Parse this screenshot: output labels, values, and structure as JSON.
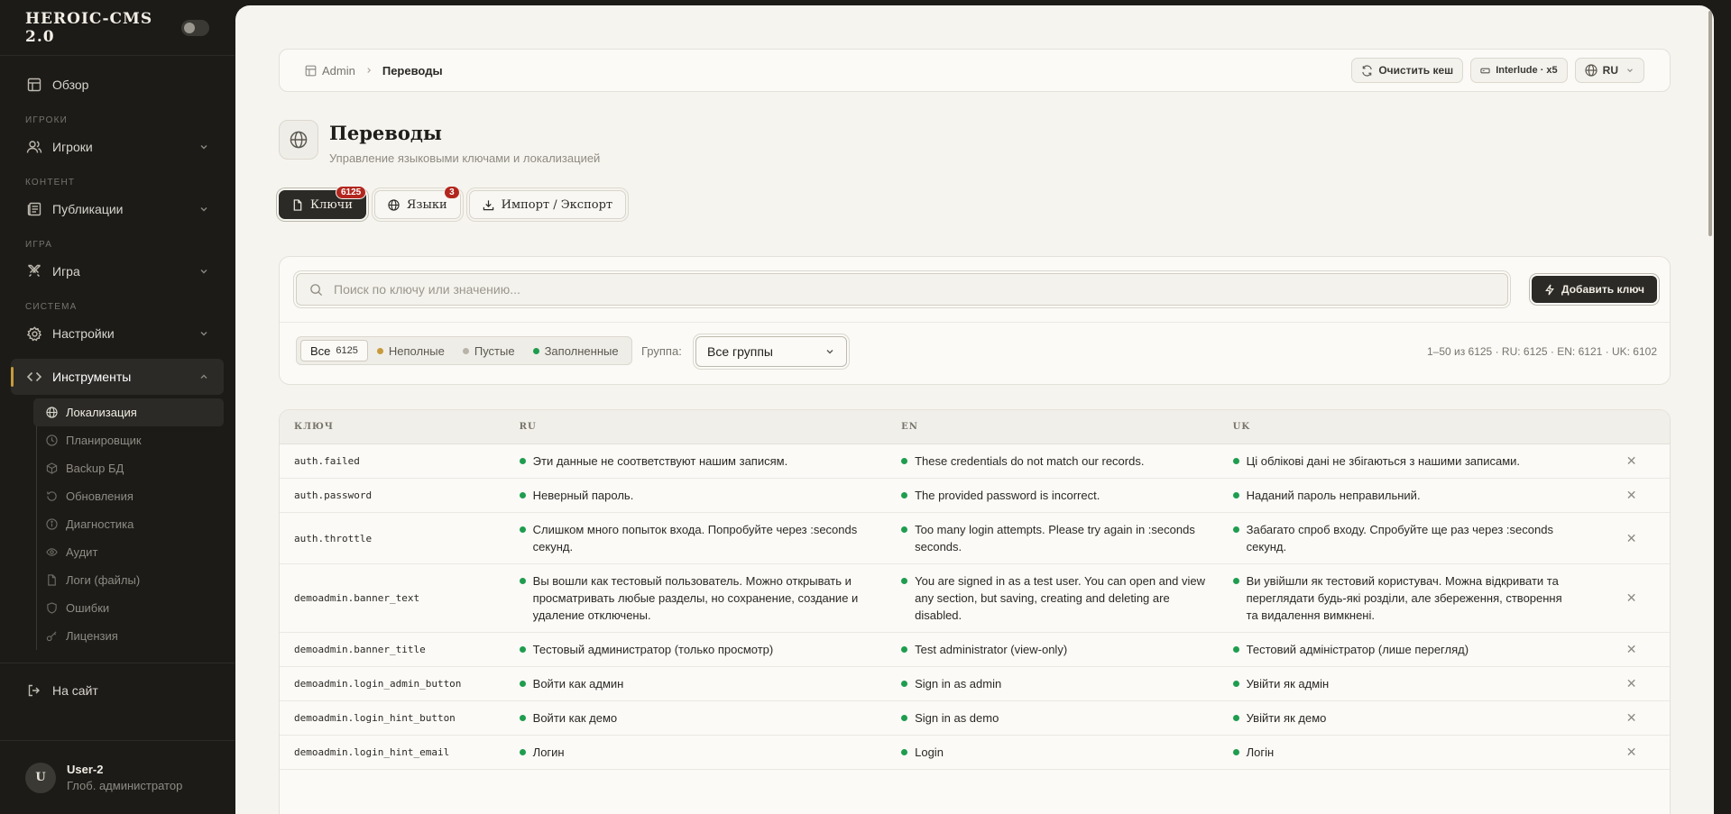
{
  "brand": {
    "title": "HEROIC-CMS 2.0"
  },
  "sidebar": {
    "overview": "Обзор",
    "sections": {
      "players": "ИГРОКИ",
      "content": "КОНТЕНТ",
      "game": "ИГРА",
      "system": "СИСТЕМА"
    },
    "players": "Игроки",
    "publications": "Публикации",
    "game": "Игра",
    "settings": "Настройки",
    "tools": "Инструменты",
    "tool_items": [
      "Локализация",
      "Планировщик",
      "Backup БД",
      "Обновления",
      "Диагностика",
      "Аудит",
      "Логи (файлы)",
      "Ошибки",
      "Лицензия"
    ],
    "to_site": "На сайт"
  },
  "user": {
    "initial": "U",
    "name": "User-2",
    "role": "Глоб. администратор"
  },
  "topbar": {
    "crumb_root": "Admin",
    "crumb_current": "Переводы",
    "clear_cache": "Очистить кеш",
    "server": "Interlude · x5",
    "lang": "RU"
  },
  "page": {
    "title": "Переводы",
    "subtitle": "Управление языковыми ключами и локализацией"
  },
  "tabs": {
    "keys": "Ключи",
    "keys_badge": "6125",
    "languages": "Языки",
    "languages_badge": "3",
    "import_export": "Импорт / Экспорт"
  },
  "filters": {
    "search_placeholder": "Поиск по ключу или значению...",
    "add_key": "Добавить ключ",
    "all": "Все",
    "all_count": "6125",
    "incomplete": "Неполные",
    "empty": "Пустые",
    "filled": "Заполненные",
    "group_label": "Группа:",
    "group_value": "Все группы",
    "stats": "1–50 из 6125 · RU: 6125 · EN: 6121 · UK: 6102"
  },
  "colors": {
    "incomplete": "#c79a3b",
    "empty": "#b8b4aa",
    "filled": "#1f9d4f"
  },
  "table": {
    "headers": {
      "key": "КЛЮЧ",
      "ru": "RU",
      "en": "EN",
      "uk": "UK"
    },
    "rows": [
      {
        "key": "auth.failed",
        "ru": "Эти данные не соответствуют нашим записям.",
        "en": "These credentials do not match our records.",
        "uk": "Ці облікові дані не збігаються з нашими записами."
      },
      {
        "key": "auth.password",
        "ru": "Неверный пароль.",
        "en": "The provided password is incorrect.",
        "uk": "Наданий пароль неправильний."
      },
      {
        "key": "auth.throttle",
        "ru": "Слишком много попыток входа. Попробуйте через :seconds секунд.",
        "en": "Too many login attempts. Please try again in :seconds seconds.",
        "uk": "Забагато спроб входу. Спробуйте ще раз через :seconds секунд."
      },
      {
        "key": "demoadmin.banner_text",
        "ru": "Вы вошли как тестовый пользователь. Можно открывать и просматривать любые разделы, но сохранение, создание и удаление отключены.",
        "en": "You are signed in as a test user. You can open and view any section, but saving, creating and deleting are disabled.",
        "uk": "Ви увійшли як тестовий користувач. Можна відкривати та переглядати будь-які розділи, але збереження, створення та видалення вимкнені."
      },
      {
        "key": "demoadmin.banner_title",
        "ru": "Тестовый администратор (только просмотр)",
        "en": "Test administrator (view-only)",
        "uk": "Тестовий адміністратор (лише перегляд)"
      },
      {
        "key": "demoadmin.login_admin_button",
        "ru": "Войти как админ",
        "en": "Sign in as admin",
        "uk": "Увійти як адмін"
      },
      {
        "key": "demoadmin.login_hint_button",
        "ru": "Войти как демо",
        "en": "Sign in as demo",
        "uk": "Увійти як демо"
      },
      {
        "key": "demoadmin.login_hint_email",
        "ru": "Логин",
        "en": "Login",
        "uk": "Логін"
      }
    ]
  }
}
